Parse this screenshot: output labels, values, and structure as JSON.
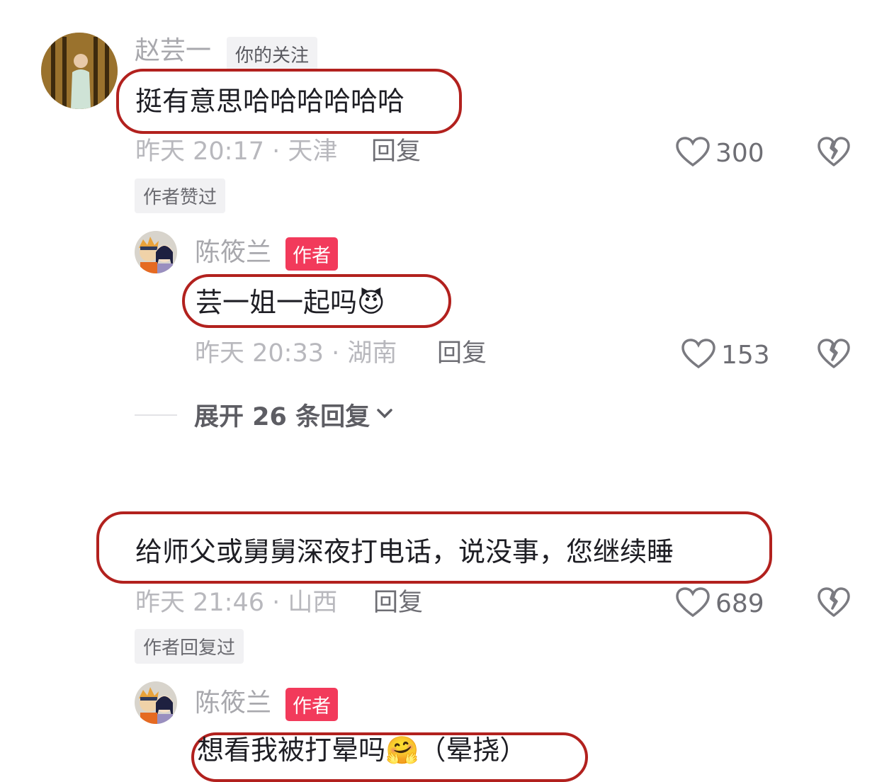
{
  "comments": [
    {
      "username": "赵芸一",
      "tag": "你的关注",
      "text": "挺有意思哈哈哈哈哈哈",
      "time_location": "昨天 20:17 · 天津",
      "reply_label": "回复",
      "likes": "300",
      "badge": "作者赞过",
      "replies": [
        {
          "username": "陈筱兰",
          "tag": "作者",
          "text": "芸一姐一起吗",
          "emoji": "😈",
          "time_location": "昨天 20:33 · 湖南",
          "reply_label": "回复",
          "likes": "153"
        }
      ],
      "expand_label": "展开 26 条回复"
    },
    {
      "text": "给师父或舅舅深夜打电话，说没事，您继续睡",
      "time_location": "昨天 21:46 · 山西",
      "reply_label": "回复",
      "likes": "689",
      "badge": "作者回复过",
      "replies": [
        {
          "username": "陈筱兰",
          "tag": "作者",
          "text": "想看我被打晕吗",
          "emoji": "🤗",
          "text_suffix": "（晕挠）"
        }
      ]
    }
  ],
  "colors": {
    "author_tag": "#f23a5b",
    "highlight_box": "#b2211e",
    "muted_text": "#b8b8bd"
  },
  "icons": {
    "like": "heart-outline-icon",
    "dislike": "broken-heart-icon",
    "expand": "chevron-down-icon"
  }
}
